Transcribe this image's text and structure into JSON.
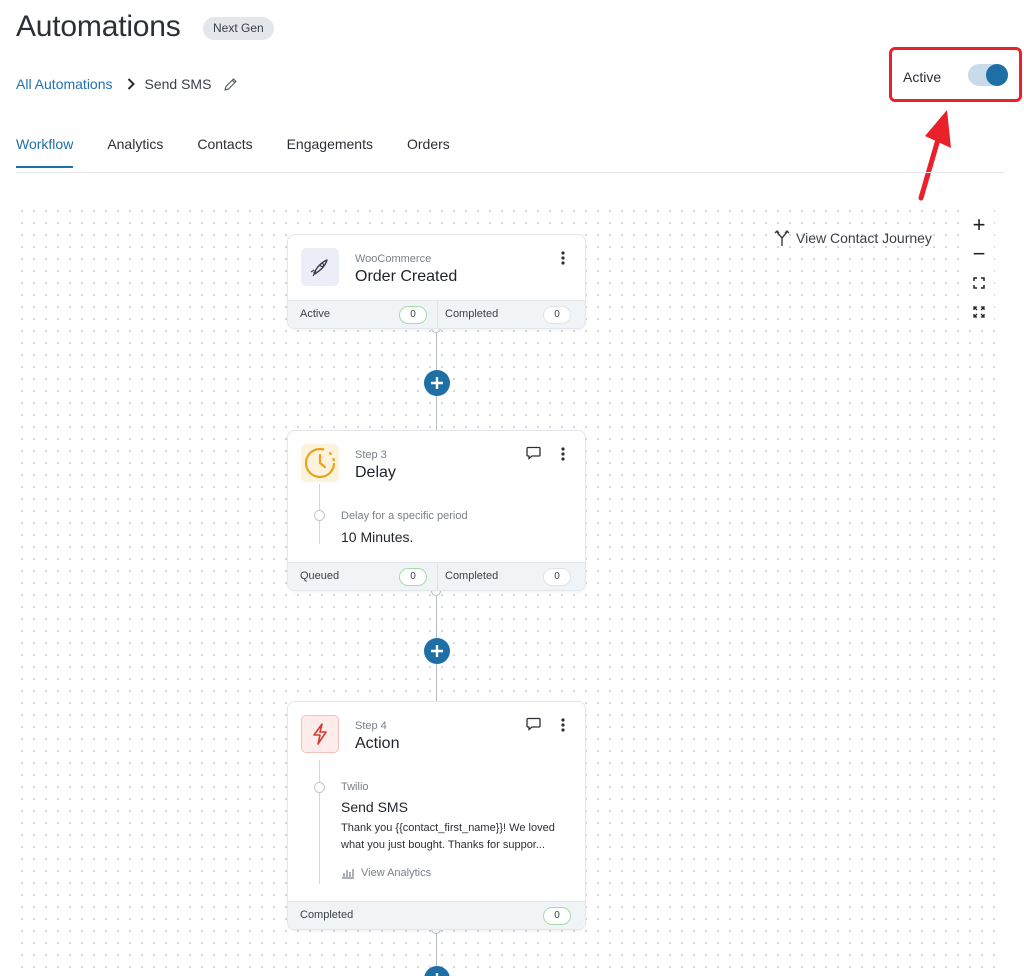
{
  "header": {
    "title": "Automations",
    "badge": "Next Gen",
    "breadcrumb_root": "All Automations",
    "breadcrumb_current": "Send SMS",
    "status_label": "Active",
    "status_active": true
  },
  "tabs": [
    {
      "label": "Workflow",
      "active": true
    },
    {
      "label": "Analytics",
      "active": false
    },
    {
      "label": "Contacts",
      "active": false
    },
    {
      "label": "Engagements",
      "active": false
    },
    {
      "label": "Orders",
      "active": false
    }
  ],
  "canvas": {
    "journey_label": "View Contact Journey",
    "zoom_in": "+",
    "zoom_out": "−"
  },
  "trigger": {
    "source": "WooCommerce",
    "title": "Order Created",
    "stat1_label": "Active",
    "stat1_value": "0",
    "stat2_label": "Completed",
    "stat2_value": "0"
  },
  "delay": {
    "step": "Step 3",
    "title": "Delay",
    "detail_sub": "Delay for a specific period",
    "detail_main": "10 Minutes.",
    "stat1_label": "Queued",
    "stat1_value": "0",
    "stat2_label": "Completed",
    "stat2_value": "0"
  },
  "action": {
    "step": "Step 4",
    "title": "Action",
    "provider": "Twilio",
    "detail_main": "Send SMS",
    "message": "Thank you {{contact_first_name}}! We loved what you just bought. Thanks for suppor...",
    "analytics_label": "View Analytics",
    "stat1_label": "Completed",
    "stat1_value": "0"
  },
  "colors": {
    "accent": "#1d6fa5",
    "highlight": "#e8212b"
  }
}
